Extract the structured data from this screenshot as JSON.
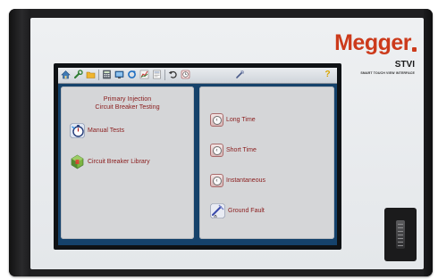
{
  "device": {
    "brand": "Megger",
    "model": "STVI",
    "model_subtitle": "SMART TOUCH VIEW INTERFACE"
  },
  "toolbar": {
    "icons": [
      "home-icon",
      "wrench-icon",
      "folder-icon",
      "calculator-icon",
      "display-icon",
      "refresh-icon",
      "chart-icon",
      "report-icon",
      "undo-icon",
      "timer-icon",
      "settings-icon",
      "help-icon"
    ],
    "help_label": "?"
  },
  "left_panel": {
    "title_line1": "Primary Injection",
    "title_line2": "Circuit Breaker Testing",
    "items": [
      {
        "label": "Manual Tests",
        "icon": "stopwatch-icon"
      },
      {
        "label": "Circuit Breaker Library",
        "icon": "breaker-library-icon"
      }
    ]
  },
  "right_panel": {
    "items": [
      {
        "label": "Long Time",
        "icon": "long-time-icon"
      },
      {
        "label": "Short Time",
        "icon": "short-time-icon"
      },
      {
        "label": "Instantaneous",
        "icon": "instantaneous-icon"
      },
      {
        "label": "Ground Fault",
        "icon": "ground-fault-icon"
      }
    ]
  },
  "colors": {
    "brand_red": "#cc3a1b",
    "screen_blue": "#15426b",
    "panel_gray": "#d5d6d8",
    "label_red": "#8a1c1c"
  }
}
